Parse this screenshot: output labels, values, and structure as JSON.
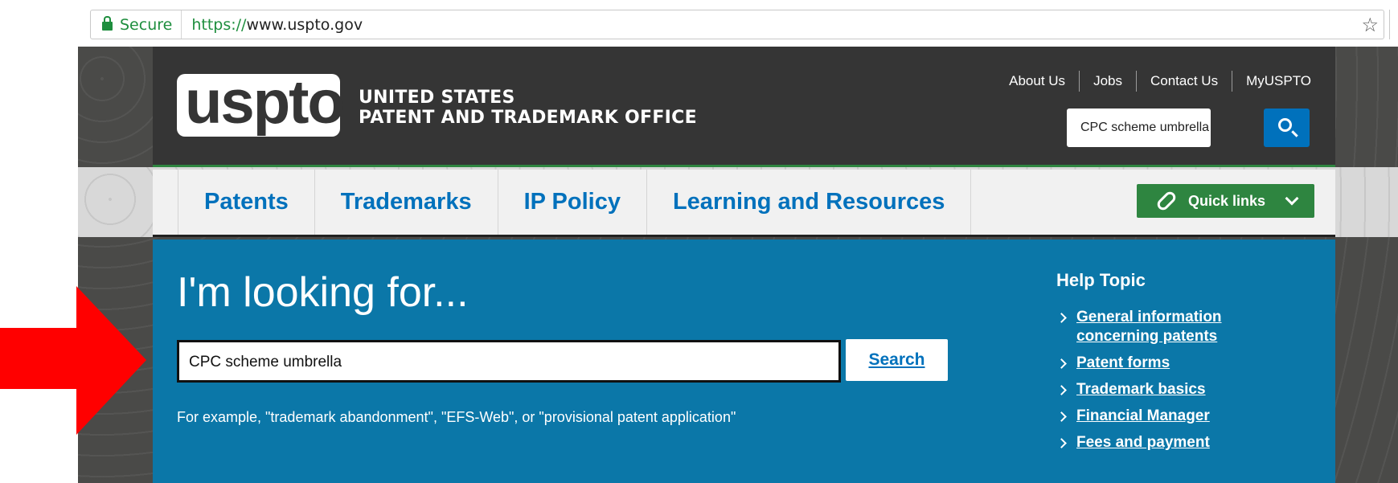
{
  "browser": {
    "secure_label": "Secure",
    "url_scheme": "https://",
    "url_host": "www.uspto.gov",
    "bookmark_icon": "star-icon"
  },
  "header": {
    "logo_text": "uspto",
    "agency_line1": "UNITED STATES",
    "agency_line2": "PATENT AND TRADEMARK OFFICE",
    "top_links": [
      "About Us",
      "Jobs",
      "Contact Us",
      "MyUSPTO"
    ],
    "search_value": "CPC scheme umbrella",
    "search_icon": "search-icon"
  },
  "nav": {
    "items": [
      "Patents",
      "Trademarks",
      "IP Policy",
      "Learning and Resources"
    ],
    "quick_links_label": "Quick links"
  },
  "main": {
    "heading": "I'm looking for...",
    "search_value": "CPC scheme umbrella",
    "search_button": "Search",
    "example_text": "For example, \"trademark abandonment\", \"EFS-Web\", or \"provisional patent application\""
  },
  "help": {
    "title": "Help Topic",
    "items": [
      "General information concerning patents",
      "Patent forms",
      "Trademark basics",
      "Financial Manager",
      "Fees and payment"
    ]
  },
  "colors": {
    "header_bg": "#353535",
    "brand_blue": "#0071bc",
    "panel_blue": "#0b77a8",
    "quick_green": "#2e8540",
    "annotation_red": "#ff0000"
  }
}
